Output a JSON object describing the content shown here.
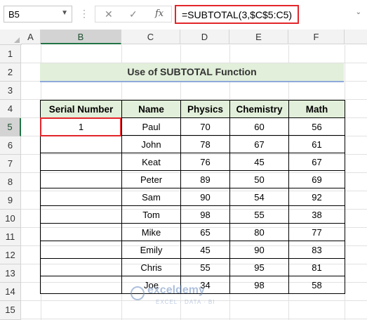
{
  "formula_bar": {
    "name_box": "B5",
    "cancel_icon": "✕",
    "enter_icon": "✓",
    "fx_label": "fx",
    "formula": "=SUBTOTAL(3,$C$5:C5)"
  },
  "columns": [
    "A",
    "B",
    "C",
    "D",
    "E",
    "F"
  ],
  "rows": [
    "1",
    "2",
    "3",
    "4",
    "5",
    "6",
    "7",
    "8",
    "9",
    "10",
    "11",
    "12",
    "13",
    "14",
    "15"
  ],
  "active_cell": "B5",
  "title": "Use of SUBTOTAL Function",
  "table": {
    "headers": [
      "Serial Number",
      "Name",
      "Physics",
      "Chemistry",
      "Math"
    ],
    "rows": [
      {
        "serial": "1",
        "name": "Paul",
        "physics": "70",
        "chemistry": "60",
        "math": "56"
      },
      {
        "serial": "",
        "name": "John",
        "physics": "78",
        "chemistry": "67",
        "math": "61"
      },
      {
        "serial": "",
        "name": "Keat",
        "physics": "76",
        "chemistry": "45",
        "math": "67"
      },
      {
        "serial": "",
        "name": "Peter",
        "physics": "89",
        "chemistry": "50",
        "math": "69"
      },
      {
        "serial": "",
        "name": "Sam",
        "physics": "90",
        "chemistry": "54",
        "math": "92"
      },
      {
        "serial": "",
        "name": "Tom",
        "physics": "98",
        "chemistry": "55",
        "math": "38"
      },
      {
        "serial": "",
        "name": "Mike",
        "physics": "65",
        "chemistry": "80",
        "math": "77"
      },
      {
        "serial": "",
        "name": "Emily",
        "physics": "45",
        "chemistry": "90",
        "math": "83"
      },
      {
        "serial": "",
        "name": "Chris",
        "physics": "55",
        "chemistry": "95",
        "math": "81"
      },
      {
        "serial": "",
        "name": "Joe",
        "physics": "34",
        "chemistry": "98",
        "math": "58"
      }
    ]
  },
  "watermark": {
    "name": "exceldemy",
    "tagline": "EXCEL · DATA · BI"
  },
  "colors": {
    "header_fill": "#e2efda",
    "highlight": "#e3262b",
    "excel_green": "#217346"
  }
}
